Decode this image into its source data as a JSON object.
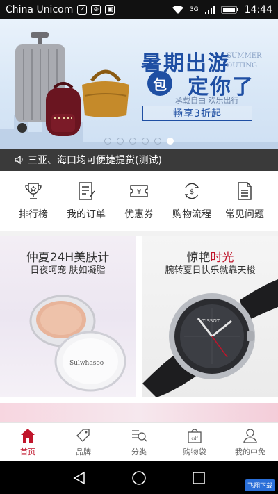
{
  "status_bar": {
    "carrier": "China Unicom",
    "network": "3G",
    "time": "14:44"
  },
  "banner": {
    "title_line1": "暑期出游",
    "title_circle": "包",
    "title_line2": "定你了",
    "en_line1": "SUMMER",
    "en_line2": "OUTING",
    "slogan": "承载自由  欢乐出行",
    "discount": "畅享3折起",
    "pagination_total": 6,
    "pagination_active": 6
  },
  "notice": {
    "text": "三亚、海口均可便捷提货(测试)"
  },
  "menu": {
    "items": [
      {
        "label": "排行榜",
        "icon": "trophy-icon"
      },
      {
        "label": "我的订单",
        "icon": "order-icon"
      },
      {
        "label": "优惠券",
        "icon": "coupon-icon"
      },
      {
        "label": "购物流程",
        "icon": "process-icon"
      },
      {
        "label": "常见问题",
        "icon": "faq-icon"
      }
    ]
  },
  "promos": {
    "left": {
      "title": "仲夏24H美肤计",
      "subtitle": "日夜呵宠 肤如凝脂",
      "brand": "Sulwhasoo"
    },
    "right": {
      "title_prefix": "惊艳",
      "title_highlight": "时光",
      "subtitle": "腕转夏日快乐就靠天梭",
      "brand": "TISSOT"
    }
  },
  "tabbar": {
    "items": [
      {
        "label": "首页",
        "icon": "home-icon"
      },
      {
        "label": "品牌",
        "icon": "brand-tag-icon"
      },
      {
        "label": "分类",
        "icon": "category-search-icon"
      },
      {
        "label": "购物袋",
        "icon": "shopping-bag-icon"
      },
      {
        "label": "我的中免",
        "icon": "user-icon"
      }
    ],
    "active_index": 0
  },
  "watermark": {
    "text": "飞翔下载"
  },
  "colors": {
    "accent": "#c0152b",
    "banner_blue": "#1f4fa3",
    "notice_bg": "#3a3a3a"
  }
}
